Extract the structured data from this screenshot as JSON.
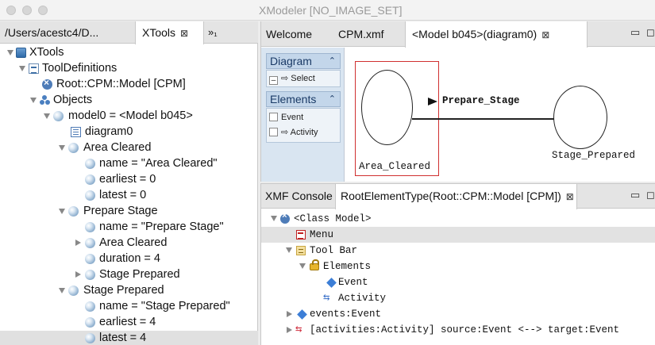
{
  "window": {
    "title": "XModeler  [NO_IMAGE_SET]"
  },
  "left_panel": {
    "tabs": {
      "path_label": "/Users/acestc4/D...",
      "active_label": "XTools",
      "active_close": "⊠",
      "more_label": "»₁"
    },
    "tree": [
      {
        "label": "XTools",
        "icon": "xtools-icon",
        "expanded": true
      },
      {
        "label": "ToolDefinitions",
        "icon": "tool-definitions-icon",
        "expanded": true
      },
      {
        "label": "Root::CPM::Model [CPM]",
        "icon": "root-class-icon"
      },
      {
        "label": "Objects",
        "icon": "objects-icon",
        "expanded": true
      },
      {
        "label": "model0 = <Model b045>",
        "icon": "object-dot-icon",
        "expanded": true
      },
      {
        "label": "diagram0",
        "icon": "diagram-icon"
      },
      {
        "label": "Area Cleared",
        "icon": "object-dot-icon",
        "expanded": true
      },
      {
        "label": "name = \"Area Cleared\"",
        "icon": "slot-dot-icon"
      },
      {
        "label": "earliest = 0",
        "icon": "slot-dot-icon"
      },
      {
        "label": "latest = 0",
        "icon": "slot-dot-icon"
      },
      {
        "label": "Prepare Stage",
        "icon": "object-dot-icon",
        "expanded": true
      },
      {
        "label": "name = \"Prepare Stage\"",
        "icon": "slot-dot-icon"
      },
      {
        "label": "Area Cleared",
        "icon": "object-dot-icon",
        "expanded": false
      },
      {
        "label": "duration = 4",
        "icon": "slot-dot-icon"
      },
      {
        "label": "Stage Prepared",
        "icon": "object-dot-icon",
        "expanded": false
      },
      {
        "label": "Stage Prepared",
        "icon": "object-dot-icon",
        "expanded": true
      },
      {
        "label": "name = \"Stage Prepared\"",
        "icon": "slot-dot-icon"
      },
      {
        "label": "earliest = 4",
        "icon": "slot-dot-icon"
      },
      {
        "label": "latest = 4",
        "icon": "slot-dot-icon",
        "selected": true
      }
    ]
  },
  "editor": {
    "tabs": {
      "welcome": "Welcome",
      "cpm": "CPM.xmf",
      "active": "<Model b045>(diagram0)",
      "active_close": "⊠",
      "minimize": "▭",
      "maximize": "◻"
    },
    "palette": {
      "diagram_header": "Diagram",
      "select_label": "⇨ Select",
      "elements_header": "Elements",
      "event_label": "Event",
      "activity_label": "⇨ Activity",
      "caret": "⌃"
    },
    "diagram": {
      "node1_label": "Area_Cleared",
      "node2_label": "Stage_Prepared",
      "edge_label": "Prepare_Stage"
    }
  },
  "console": {
    "tabs": {
      "console_label": "XMF Console",
      "active_label": "RootElementType(Root::CPM::Model [CPM])",
      "active_close": "⊠",
      "minimize": "▭",
      "maximize": "◻"
    },
    "tree": [
      {
        "label": "<Class Model>",
        "icon": "class-icon",
        "expanded": true
      },
      {
        "label": "Menu",
        "icon": "menu-icon",
        "selected": true
      },
      {
        "label": "Tool Bar",
        "icon": "toolbar-icon",
        "expanded": true
      },
      {
        "label": "Elements",
        "icon": "lock-icon",
        "expanded": true
      },
      {
        "label": "Event",
        "icon": "event-diamond-icon"
      },
      {
        "label": "Activity",
        "icon": "activity-icon"
      },
      {
        "label": "events:Event",
        "icon": "event-diamond-icon",
        "expanded": false
      },
      {
        "label": "[activities:Activity] source:Event <--> target:Event",
        "icon": "association-icon",
        "expanded": false
      }
    ]
  }
}
